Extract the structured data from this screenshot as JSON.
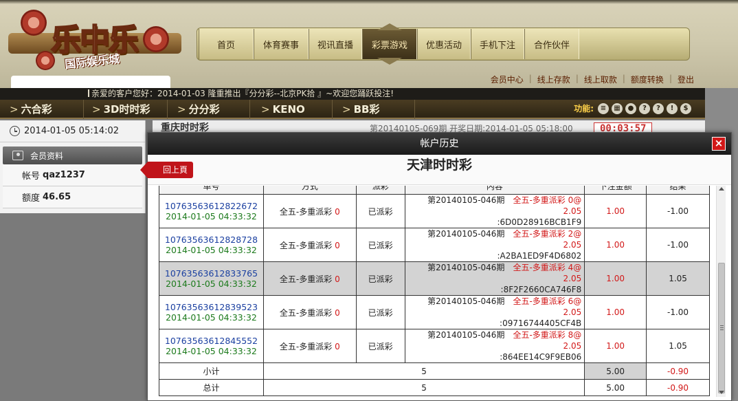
{
  "logo": {
    "main": "乐中乐",
    "sub": "国际娱乐城"
  },
  "nav": {
    "items": [
      "首页",
      "体育赛事",
      "视讯直播",
      "彩票游戏",
      "优惠活动",
      "手机下注",
      "合作伙伴"
    ],
    "active": "彩票游戏"
  },
  "sub_links": [
    "会员中心",
    "线上存款",
    "线上取款",
    "额度转换",
    "登出"
  ],
  "marquee": "亲爱的客户您好：2014-01-03 隆重推出『分分彩--北京PK拾 』~欢迎您踊跃投注!",
  "games": [
    "六合彩",
    "3D时时彩",
    "分分彩",
    "KENO",
    "BB彩"
  ],
  "func_label": "功能:",
  "func_icons": [
    "coins-icon",
    "calendar-icon",
    "user-icon",
    "question-icon",
    "help-icon",
    "shield-icon",
    "dollar-icon"
  ],
  "sidebar": {
    "datetime": "2014-01-05 05:14:02",
    "member_header": "会员资料",
    "account_label": "帐号",
    "account_value": "qaz1237",
    "balance_label": "额度",
    "balance_value": "46.65"
  },
  "main_strip": {
    "lottery": "重庆时时彩",
    "period": "第20140105-069期 开奖日期:2014-01-05 05:18:00",
    "timer": "00:03:57"
  },
  "modal": {
    "title": "帐户历史",
    "close": "×",
    "back_button": "回上頁",
    "lottery_title": "天津时时彩"
  },
  "table": {
    "headers": [
      "单号",
      "方式",
      "派彩",
      "内容",
      "下注金额",
      "结果"
    ],
    "rows": [
      {
        "id": "10763563612822672",
        "time": "2014-01-05 04:33:32",
        "method": "全五-多重派彩",
        "method_num": "0",
        "status": "已派彩",
        "period": "第20140105-046期",
        "bet": "全五-多重派彩 0@",
        "odds": "2.05",
        "hash": ":6D0D28916BCB1F9",
        "amount": "1.00",
        "result": "-1.00"
      },
      {
        "id": "10763563612828728",
        "time": "2014-01-05 04:33:32",
        "method": "全五-多重派彩",
        "method_num": "0",
        "status": "已派彩",
        "period": "第20140105-046期",
        "bet": "全五-多重派彩 2@",
        "odds": "2.05",
        "hash": ":A2BA1ED9F4D6802",
        "amount": "1.00",
        "result": "-1.00"
      },
      {
        "id": "10763563612833765",
        "time": "2014-01-05 04:33:32",
        "method": "全五-多重派彩",
        "method_num": "0",
        "status": "已派彩",
        "period": "第20140105-046期",
        "bet": "全五-多重派彩 4@",
        "odds": "2.05",
        "hash": ":8F2F2660CA746F8",
        "amount": "1.00",
        "result": "1.05"
      },
      {
        "id": "10763563612839523",
        "time": "2014-01-05 04:33:32",
        "method": "全五-多重派彩",
        "method_num": "0",
        "status": "已派彩",
        "period": "第20140105-046期",
        "bet": "全五-多重派彩 6@",
        "odds": "2.05",
        "hash": ":09716744405CF4B",
        "amount": "1.00",
        "result": "-1.00"
      },
      {
        "id": "10763563612845552",
        "time": "2014-01-05 04:33:32",
        "method": "全五-多重派彩",
        "method_num": "0",
        "status": "已派彩",
        "period": "第20140105-046期",
        "bet": "全五-多重派彩 8@",
        "odds": "2.05",
        "hash": ":864EE14C9F9EB06",
        "amount": "1.00",
        "result": "1.05"
      }
    ],
    "subtotal": {
      "label": "小计",
      "count": "5",
      "amount": "5.00",
      "result": "-0.90"
    },
    "total": {
      "label": "总计",
      "count": "5",
      "amount": "5.00",
      "result": "-0.90"
    }
  }
}
